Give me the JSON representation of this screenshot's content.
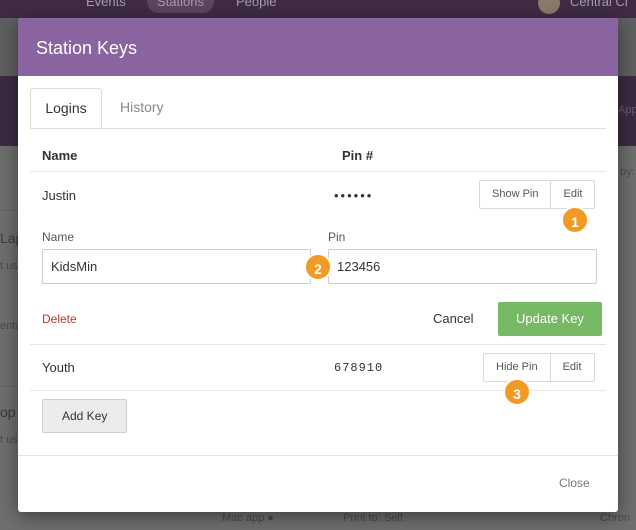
{
  "background": {
    "nav": [
      "Events",
      "Stations",
      "People"
    ],
    "user_name": "Central Cl",
    "side_texts": [
      "Lap",
      "t us",
      "enta",
      "op",
      "t us",
      "by:"
    ],
    "footer_items": [
      "Mac app",
      "Print to: Self",
      "Chron"
    ],
    "right_edge_text": "App"
  },
  "modal": {
    "title": "Station Keys",
    "tabs": [
      {
        "label": "Logins",
        "active": true
      },
      {
        "label": "History",
        "active": false
      }
    ],
    "table": {
      "headers": {
        "name": "Name",
        "pin": "Pin #"
      },
      "rows": [
        {
          "name": "Justin",
          "pin_display": "••••••",
          "toggle_label": "Show Pin",
          "edit_label": "Edit"
        },
        {
          "name": "Youth",
          "pin_display": "678910",
          "toggle_label": "Hide Pin",
          "edit_label": "Edit"
        }
      ]
    },
    "edit_form": {
      "name_label": "Name",
      "name_value": "KidsMin",
      "pin_label": "Pin",
      "pin_value": "123456",
      "delete_label": "Delete",
      "cancel_label": "Cancel",
      "submit_label": "Update Key"
    },
    "add_key_label": "Add Key",
    "close_label": "Close"
  },
  "markers": [
    "1",
    "2",
    "3"
  ],
  "colors": {
    "header": "#8a64a0",
    "primary": "#76b864",
    "danger": "#c0392b",
    "marker": "#f39a25"
  }
}
